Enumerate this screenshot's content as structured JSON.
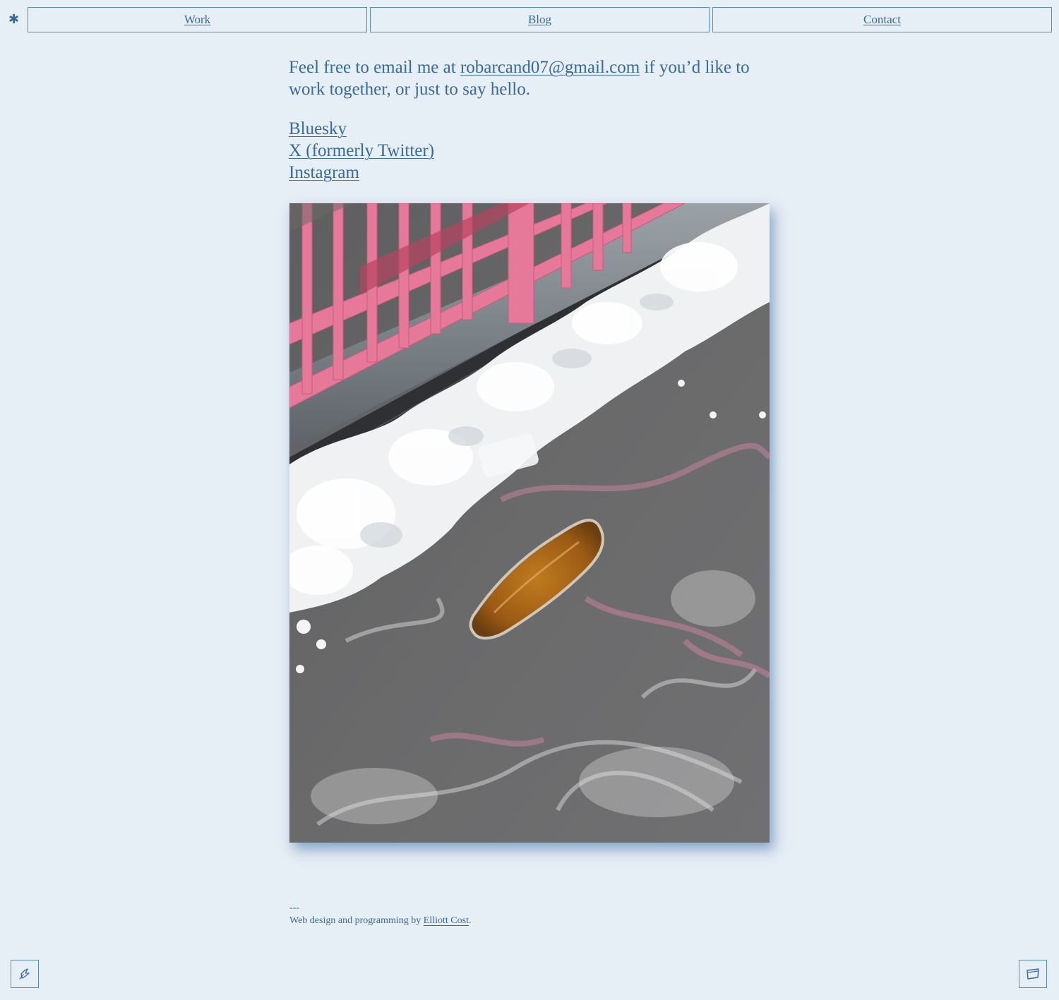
{
  "nav": {
    "logo_glyph": "✱",
    "items": [
      {
        "label": "Work"
      },
      {
        "label": "Blog"
      },
      {
        "label": "Contact"
      }
    ]
  },
  "contact": {
    "intro_before": "Feel free to email me at ",
    "email": "robarcand07@gmail.com",
    "intro_after": " if you’d like to work together, or just to say hello.",
    "social_links": [
      {
        "label": "Bluesky"
      },
      {
        "label": "X (formerly Twitter)"
      },
      {
        "label": "Instagram"
      }
    ]
  },
  "footer": {
    "separator": "---",
    "credit_before": "Web design and programming by ",
    "credit_link": "Elliott Cost",
    "credit_after": "."
  },
  "icons": {
    "bottom_left": "pointer-hand-icon",
    "bottom_right": "card-icon"
  },
  "colors": {
    "background": "#e6eef6",
    "text": "#3a6a9c",
    "border": "#5a8bbf"
  }
}
